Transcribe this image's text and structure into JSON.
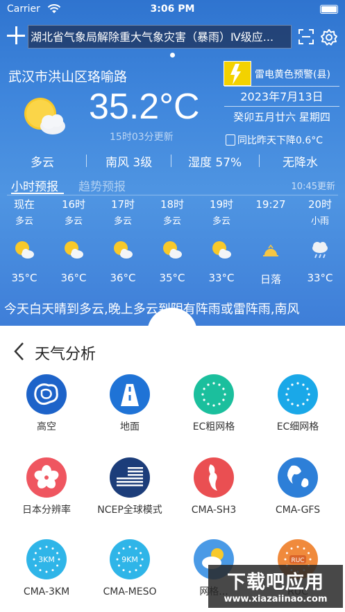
{
  "status_bar": {
    "carrier": "Carrier",
    "time": "3:06 PM"
  },
  "header": {
    "alert_text": "湖北省气象局解除重大气象灾害（暴雨）Ⅳ级应..."
  },
  "location": "武汉市洪山区珞喻路",
  "warning": {
    "text": "雷电黄色预警(县)"
  },
  "current": {
    "temperature": "35.2°C",
    "updated": "15时03分更新",
    "date": "2023年7月13日",
    "lunar": "癸卯五月廿六 星期四",
    "compare": "同比昨天下降0.6°C"
  },
  "metrics": {
    "condition": "多云",
    "wind": "南风 3级",
    "humidity": "湿度 57%",
    "precip": "无降水"
  },
  "tabs": {
    "hourly": "小时预报",
    "trend": "趋势预报",
    "updated": "10:45更新"
  },
  "hourly": [
    {
      "time": "现在",
      "cond": "多云",
      "icon": "partly-cloudy-icon",
      "temp": "35°C"
    },
    {
      "time": "16时",
      "cond": "多云",
      "icon": "partly-cloudy-icon",
      "temp": "36°C"
    },
    {
      "time": "17时",
      "cond": "多云",
      "icon": "partly-cloudy-icon",
      "temp": "36°C"
    },
    {
      "time": "18时",
      "cond": "多云",
      "icon": "partly-cloudy-icon",
      "temp": "35°C"
    },
    {
      "time": "19时",
      "cond": "多云",
      "icon": "partly-cloudy-icon",
      "temp": "33°C"
    },
    {
      "time": "19:27",
      "cond": "",
      "icon": "sunset-icon",
      "temp": "日落"
    },
    {
      "time": "20时",
      "cond": "小雨",
      "icon": "light-rain-icon",
      "temp": "33°C"
    }
  ],
  "forecast_ticker": "今天白天晴到多云,晚上多云到阴有阵雨或雷阵雨,南风",
  "analysis": {
    "title": "天气分析",
    "items": [
      {
        "label": "高空",
        "icon": "upper-air-icon",
        "color": "#1d63c9"
      },
      {
        "label": "地面",
        "icon": "road-icon",
        "color": "#1f73d6"
      },
      {
        "label": "EC粗网格",
        "icon": "ec-coarse-icon",
        "color": "#1bbf9d"
      },
      {
        "label": "EC细网格",
        "icon": "ec-fine-icon",
        "color": "#1aa8e8"
      },
      {
        "label": "日本分辨率",
        "icon": "japan-flower-icon",
        "color": "#ef5660"
      },
      {
        "label": "NCEP全球模式",
        "icon": "us-flag-icon",
        "color": "#1c3d7a"
      },
      {
        "label": "CMA-SH3",
        "icon": "shanghai-map-icon",
        "color": "#ea4f52"
      },
      {
        "label": "CMA-GFS",
        "icon": "globe-icon",
        "color": "#2d7fd8"
      },
      {
        "label": "CMA-3KM",
        "icon": "3km-badge-icon",
        "color": "#2fb5e8"
      },
      {
        "label": "CMA-MESO",
        "icon": "9km-badge-icon",
        "color": "#2fb5e8"
      },
      {
        "label": "网格...",
        "icon": "grid-weather-icon",
        "color": "#4a9ae6"
      },
      {
        "label": "RUC",
        "icon": "ruc-badge-icon",
        "color": "#f08a3c"
      }
    ]
  },
  "watermark": {
    "main": "下载吧应用",
    "url": "www.xiazaiinao.com"
  }
}
